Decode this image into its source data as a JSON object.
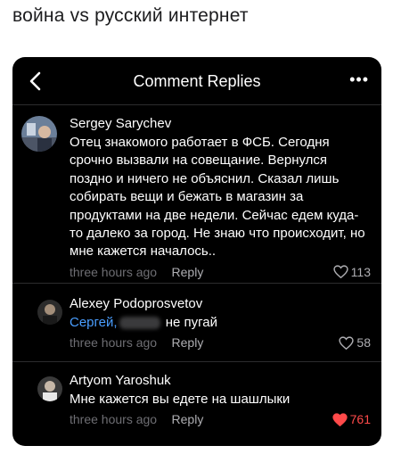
{
  "headline": "война vs русский интернет",
  "header": {
    "title": "Comment Replies",
    "more": "•••"
  },
  "comments": [
    {
      "author": "Sergey Sarychev",
      "text": "Отец знакомого работает в ФСБ. Сегодня срочно вызвали на совещание. Вернулся поздно и ничего не объяснил. Сказал лишь собирать вещи и бежать в магазин за продуктами на две недели. Сейчас едем куда-то далеко за город. Не знаю что происходит, но мне кажется началось..",
      "time": "three hours ago",
      "reply": "Reply",
      "likes": "113",
      "liked": false
    },
    {
      "author": "Alexey Podoprosvetov",
      "mention": "Сергей,",
      "text": "не пугай",
      "time": "three hours ago",
      "reply": "Reply",
      "likes": "58",
      "liked": false
    },
    {
      "author": "Artyom Yaroshuk",
      "text": "Мне кажется вы едете на шашлыки",
      "time": "three hours ago",
      "reply": "Reply",
      "likes": "761",
      "liked": true
    }
  ],
  "colors": {
    "background": "#000000",
    "mention": "#4a9eff",
    "liked_heart": "#ff4a4a"
  }
}
